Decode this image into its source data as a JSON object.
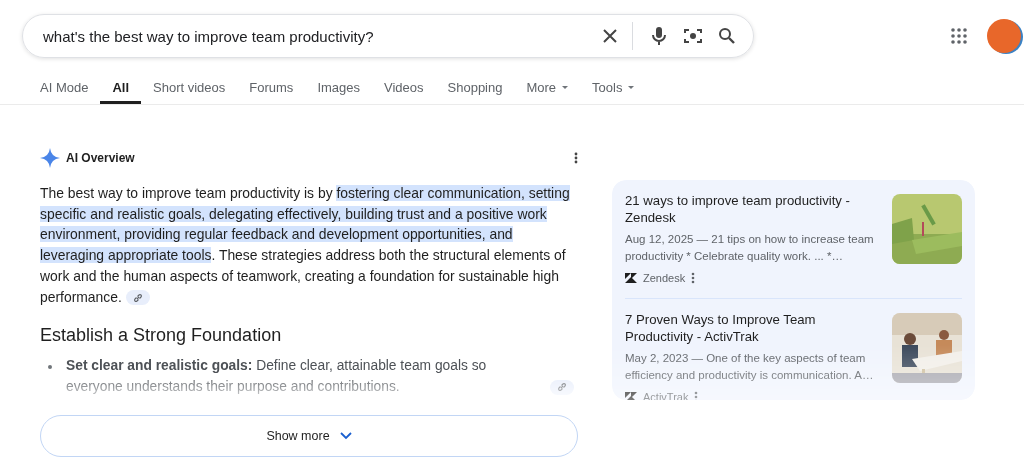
{
  "search": {
    "value": "what's the best way to improve team productivity?"
  },
  "tabs": [
    {
      "label": "AI Mode",
      "selected": false,
      "menu": false
    },
    {
      "label": "All",
      "selected": true,
      "menu": false
    },
    {
      "label": "Short videos",
      "selected": false,
      "menu": false
    },
    {
      "label": "Forums",
      "selected": false,
      "menu": false
    },
    {
      "label": "Images",
      "selected": false,
      "menu": false
    },
    {
      "label": "Videos",
      "selected": false,
      "menu": false
    },
    {
      "label": "Shopping",
      "selected": false,
      "menu": false
    },
    {
      "label": "More",
      "selected": false,
      "menu": true
    },
    {
      "label": "Tools",
      "selected": false,
      "menu": true
    }
  ],
  "overview": {
    "title": "AI Overview",
    "summary": {
      "before": "The best way to improve team productivity is by ",
      "highlight": "fostering clear communication, setting specific and realistic goals, delegating effectively, building trust and a positive work environment, providing regular feedback and development opportunities, and leveraging appropriate tools",
      "after": ". These strategies address both the structural elements of work and the human aspects of teamwork, creating a foundation for sustainable high performance."
    },
    "heading": "Establish a Strong Foundation",
    "bullets": [
      {
        "text": "**Set clear and realistic goals:** Define clear, attainable team goals so everyone understands their purpose and contributions."
      }
    ],
    "show_more": "Show more"
  },
  "sources": [
    {
      "title": "21 ways to improve team productivity - Zendesk",
      "snippet": "Aug 12, 2025 — 21 tips on how to increase team productivity * Celebrate quality work. ... *…",
      "site": "Zendesk"
    },
    {
      "title": "7 Proven Ways to Improve Team Productivity - ActivTrak",
      "snippet": "May 2, 2023 — One of the key aspects of team efficiency and productivity is communication. A…",
      "site": "ActivTrak"
    }
  ]
}
